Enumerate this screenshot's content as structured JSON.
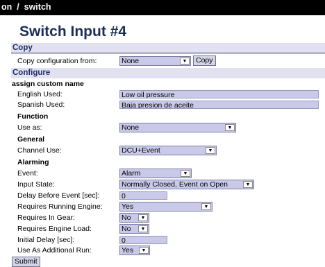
{
  "header": {
    "breadcrumb": "on  /  switch"
  },
  "title": "Switch Input #4",
  "copy": {
    "section_label": "Copy",
    "from_label": "Copy configuration from:",
    "from_value": "None",
    "copy_button": "Copy"
  },
  "configure": {
    "section_label": "Configure",
    "custom_name_heading": "assign custom name",
    "english_label": "English Used:",
    "english_value": "Low oil pressure",
    "spanish_label": "Spanish Used:",
    "spanish_value": "Baja presion de aceite",
    "function_heading": "Function",
    "use_as_label": "Use as:",
    "use_as_value": "None",
    "general_heading": "General",
    "channel_use_label": "Channel Use:",
    "channel_use_value": "DCU+Event",
    "alarming_heading": "Alarming",
    "event_label": "Event:",
    "event_value": "Alarm",
    "input_state_label": "Input State:",
    "input_state_value": "Normally Closed, Event on Open",
    "delay_label": "Delay Before Event [sec]:",
    "delay_value": "0",
    "requires_running_label": "Requires Running Engine:",
    "requires_running_value": "Yes",
    "requires_gear_label": "Requires In Gear:",
    "requires_gear_value": "No",
    "requires_load_label": "Requires Engine Load:",
    "requires_load_value": "No",
    "initial_delay_label": "Initial Delay [sec]:",
    "initial_delay_value": "0",
    "additional_run_label": "Use As Additional Run:",
    "additional_run_value": "Yes"
  },
  "submit_label": "Submit"
}
